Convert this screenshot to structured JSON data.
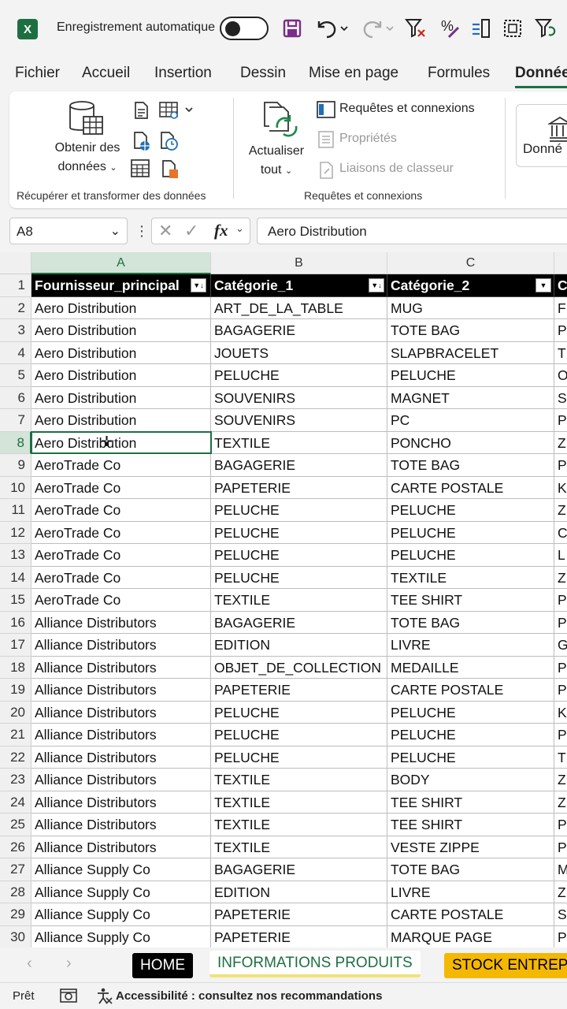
{
  "titlebar": {
    "app_logo_letter": "X",
    "autosave_label": "Enregistrement automatique"
  },
  "tabs": [
    {
      "label": "Fichier"
    },
    {
      "label": "Accueil"
    },
    {
      "label": "Insertion"
    },
    {
      "label": "Dessin"
    },
    {
      "label": "Mise en page"
    },
    {
      "label": "Formules"
    },
    {
      "label": "Données",
      "active": true
    }
  ],
  "ribbon": {
    "get_data_label_line1": "Obtenir des",
    "get_data_label_line2": "données",
    "refresh_label_line1": "Actualiser",
    "refresh_label_line2": "tout",
    "queries_connections": "Requêtes et connexions",
    "properties": "Propriétés",
    "workbook_links": "Liaisons de classeur",
    "data_types_label": "Donné",
    "group1_label": "Récupérer et transformer des données",
    "group2_label": "Requêtes et connexions"
  },
  "formula_bar": {
    "name_box": "A8",
    "fx_label": "fx",
    "formula": "Aero Distribution"
  },
  "sheet": {
    "column_letters": [
      "A",
      "B",
      "C",
      "C"
    ],
    "headers": [
      "Fournisseur_principal",
      "Catégorie_1",
      "Catégorie_2",
      "C"
    ],
    "rows": [
      {
        "n": "2",
        "a": "Aero Distribution",
        "b": "ART_DE_LA_TABLE",
        "c": "MUG",
        "d": "F"
      },
      {
        "n": "3",
        "a": "Aero Distribution",
        "b": "BAGAGERIE",
        "c": "TOTE BAG",
        "d": "P"
      },
      {
        "n": "4",
        "a": "Aero Distribution",
        "b": "JOUETS",
        "c": "SLAPBRACELET",
        "d": "T"
      },
      {
        "n": "5",
        "a": "Aero Distribution",
        "b": "PELUCHE",
        "c": "PELUCHE",
        "d": "O"
      },
      {
        "n": "6",
        "a": "Aero Distribution",
        "b": "SOUVENIRS",
        "c": "MAGNET",
        "d": "S"
      },
      {
        "n": "7",
        "a": "Aero Distribution",
        "b": "SOUVENIRS",
        "c": "PC",
        "d": "P"
      },
      {
        "n": "8",
        "a": "Aero Distribution",
        "b": "TEXTILE",
        "c": "PONCHO",
        "d": "Z"
      },
      {
        "n": "9",
        "a": "AeroTrade Co",
        "b": "BAGAGERIE",
        "c": "TOTE BAG",
        "d": "P"
      },
      {
        "n": "10",
        "a": "AeroTrade Co",
        "b": "PAPETERIE",
        "c": "CARTE POSTALE",
        "d": "K"
      },
      {
        "n": "11",
        "a": "AeroTrade Co",
        "b": "PELUCHE",
        "c": "PELUCHE",
        "d": "Z"
      },
      {
        "n": "12",
        "a": "AeroTrade Co",
        "b": "PELUCHE",
        "c": "PELUCHE",
        "d": "C"
      },
      {
        "n": "13",
        "a": "AeroTrade Co",
        "b": "PELUCHE",
        "c": "PELUCHE",
        "d": "L"
      },
      {
        "n": "14",
        "a": "AeroTrade Co",
        "b": "PELUCHE",
        "c": "TEXTILE",
        "d": "Z"
      },
      {
        "n": "15",
        "a": "AeroTrade Co",
        "b": "TEXTILE",
        "c": "TEE SHIRT",
        "d": "P"
      },
      {
        "n": "16",
        "a": "Alliance Distributors",
        "b": "BAGAGERIE",
        "c": "TOTE BAG",
        "d": "P"
      },
      {
        "n": "17",
        "a": "Alliance Distributors",
        "b": "EDITION",
        "c": "LIVRE",
        "d": "G"
      },
      {
        "n": "18",
        "a": "Alliance Distributors",
        "b": "OBJET_DE_COLLECTION",
        "c": "MEDAILLE",
        "d": "P"
      },
      {
        "n": "19",
        "a": "Alliance Distributors",
        "b": "PAPETERIE",
        "c": "CARTE POSTALE",
        "d": "P"
      },
      {
        "n": "20",
        "a": "Alliance Distributors",
        "b": "PELUCHE",
        "c": "PELUCHE",
        "d": "K"
      },
      {
        "n": "21",
        "a": "Alliance Distributors",
        "b": "PELUCHE",
        "c": "PELUCHE",
        "d": "P"
      },
      {
        "n": "22",
        "a": "Alliance Distributors",
        "b": "PELUCHE",
        "c": "PELUCHE",
        "d": "T"
      },
      {
        "n": "23",
        "a": "Alliance Distributors",
        "b": "TEXTILE",
        "c": "BODY",
        "d": "Z"
      },
      {
        "n": "24",
        "a": "Alliance Distributors",
        "b": "TEXTILE",
        "c": "TEE SHIRT",
        "d": "Z"
      },
      {
        "n": "25",
        "a": "Alliance Distributors",
        "b": "TEXTILE",
        "c": "TEE SHIRT",
        "d": "P"
      },
      {
        "n": "26",
        "a": "Alliance Distributors",
        "b": "TEXTILE",
        "c": "VESTE ZIPPE",
        "d": "P"
      },
      {
        "n": "27",
        "a": "Alliance Supply Co",
        "b": "BAGAGERIE",
        "c": "TOTE BAG",
        "d": "M"
      },
      {
        "n": "28",
        "a": "Alliance Supply Co",
        "b": "EDITION",
        "c": "LIVRE",
        "d": "Z"
      },
      {
        "n": "29",
        "a": "Alliance Supply Co",
        "b": "PAPETERIE",
        "c": "CARTE POSTALE",
        "d": "S"
      },
      {
        "n": "30",
        "a": "Alliance Supply Co",
        "b": "PAPETERIE",
        "c": "MARQUE PAGE",
        "d": "P"
      }
    ]
  },
  "sheet_tabs": [
    {
      "label": "HOME",
      "style": "dark"
    },
    {
      "label": "INFORMATIONS PRODUITS",
      "style": "active"
    },
    {
      "label": "STOCK ENTREPO",
      "style": "gold"
    }
  ],
  "status": {
    "ready": "Prêt",
    "accessibility": "Accessibilité : consultez nos recommandations"
  },
  "colors": {
    "excel_green": "#1d6f42",
    "save_purple": "#7b2c8a",
    "header_black": "#000000",
    "tab_gold": "#f5b800",
    "tab_active_underline": "#f0e27a"
  }
}
